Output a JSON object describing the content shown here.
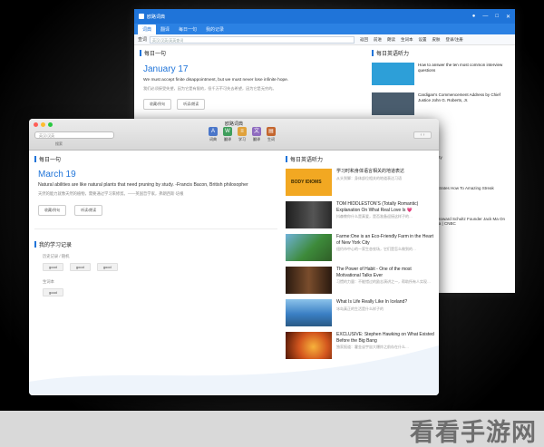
{
  "watermark": "看看手游网",
  "back_window": {
    "title": "欧路词典",
    "tabs": [
      "词典",
      "翻译",
      "每日一句",
      "我的记录"
    ],
    "search_label": "查词",
    "search_placeholder": "英汉/汉英/英英查词",
    "tools": [
      "返回",
      "前进",
      "朗读",
      "生词本",
      "设置",
      "皮肤",
      "登录/注册"
    ],
    "daily": {
      "heading": "每日一句",
      "date": "January 17",
      "en": "We must accept finite disappointment, but we must never lose infinite hope.",
      "cn": "我们必须接受失望，因为它是有限的，但千万不可失去希望，因为它是无穷的。",
      "buttons": [
        "收藏/例句",
        "听读/朗读"
      ]
    },
    "listening": {
      "heading": "每日英语听力",
      "items": [
        {
          "title": "How to answer the ten most common interview questions",
          "thumb": "#2d9fd8"
        },
        {
          "title": "Cardigan's Commencement Address by Chief Justice John G. Roberts, Jr.",
          "thumb": "#4a5d6e"
        }
      ],
      "more": [
        "的全国演讲比赛：可以说说英语",
        "Real Exam Anxiety",
        "Rumsay Demonstrates How To Amazing Streak",
        "Starbucks CEO Howard Schultz Founder Jack Ma On Business In China | CNBC"
      ]
    }
  },
  "front_window": {
    "title": "欧路词典",
    "search_placeholder": "英汉/汉英",
    "search_label": "搜索",
    "tools": [
      {
        "label": "词典",
        "color": "#4a76c9",
        "glyph": "A"
      },
      {
        "label": "翻译",
        "color": "#3f9e5c",
        "glyph": "W"
      },
      {
        "label": "学习",
        "color": "#e0a23c",
        "glyph": "≡"
      },
      {
        "label": "翻译",
        "color": "#8e6bbf",
        "glyph": "文"
      },
      {
        "label": "生词",
        "color": "#c4662f",
        "glyph": "▤"
      }
    ],
    "daily": {
      "heading": "每日一句",
      "date": "March 19",
      "en": "Natural abilities are like natural plants that need pruning by study. -Francis Bacon, British philosopher",
      "cn": "天然的能力就像天然的植物，需要通过学习来修剪。——英国哲学家，弗朗西斯·培根",
      "buttons": [
        "收藏/例句",
        "听读/朗读"
      ]
    },
    "records": {
      "heading": "我的学习记录",
      "history_label": "历史记录 / 随机",
      "history_tags": [
        "good",
        "good",
        "good"
      ],
      "words_label": "生词本",
      "word_tags": [
        "good"
      ]
    },
    "listening": {
      "heading": "每日英语听力",
      "items": [
        {
          "title": "学习时和身体语言相关的地道表达",
          "sub": "从头到脚：身体部位相关的地道表达习语",
          "thumb": "#f2a822",
          "thumb_text": "BODY IDIOMS"
        },
        {
          "title": "TOM HIDDLESTON'S (Totally Romantic) Explanation On What Real Love Is 💗",
          "sub": "抖森教你什么是真爱，是否准备迎接这样子的…",
          "thumb": "#2b2b2b"
        },
        {
          "title": "Farme:One is an Eco-Friendly Farm in the Heart of New York City",
          "sub": "纽约市中心的一家生态农场，它们是怎么做到的…",
          "thumb": "#3d8a3a"
        },
        {
          "title": "The Power of Habit - One of the most Motivational Talks Ever",
          "sub": "习惯的力量：不能错过的励志演讲之一，帮助所有人实现…",
          "thumb": "#7a4d2c"
        },
        {
          "title": "What Is Life Really Like In Iceland?",
          "sub": "冰岛真正的生活是什么样子的",
          "thumb": "#3a7fc4"
        },
        {
          "title": "EXCLUSIVE: Stephen Hawking on What Existed Before the Big Bang",
          "sub": "独家报道：霍金谈宇宙大爆炸之前存在什么…",
          "thumb": "#d3561e"
        }
      ]
    }
  }
}
